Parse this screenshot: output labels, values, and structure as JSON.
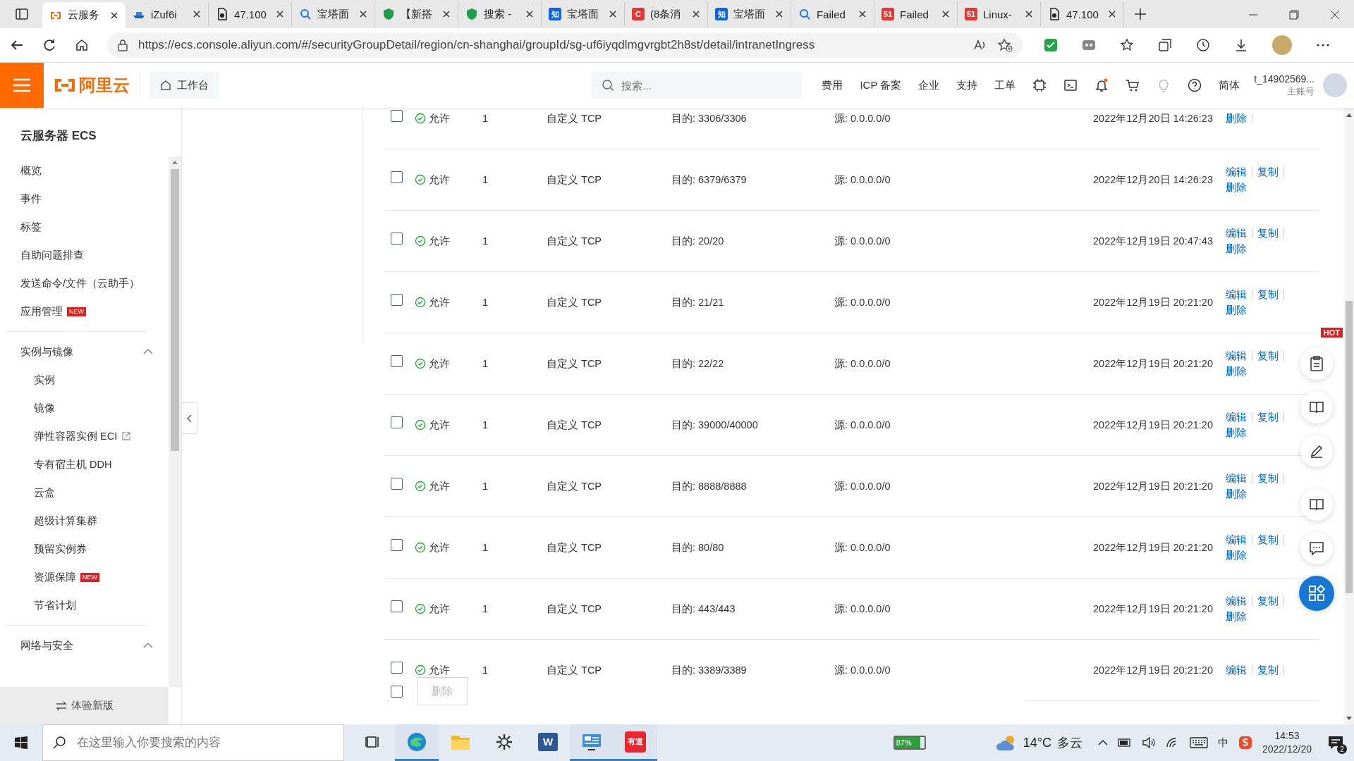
{
  "browser": {
    "tabs": [
      {
        "label": "云服务",
        "kind": "aliyun",
        "selected": true
      },
      {
        "label": "iZuf6i",
        "kind": "ship",
        "selected": false
      },
      {
        "label": "47.100",
        "kind": "doc",
        "selected": false
      },
      {
        "label": "宝塔面",
        "kind": "search",
        "selected": false
      },
      {
        "label": "【新搭",
        "kind": "shield",
        "selected": false
      },
      {
        "label": "搜索 -",
        "kind": "shield",
        "selected": false
      },
      {
        "label": "宝塔面",
        "kind": "badge",
        "icon_text": "知",
        "selected": false
      },
      {
        "label": "(8条消",
        "kind": "red",
        "icon_text": "C",
        "selected": false
      },
      {
        "label": "宝塔面",
        "kind": "badge",
        "icon_text": "知",
        "selected": false
      },
      {
        "label": "Failed",
        "kind": "search",
        "selected": false
      },
      {
        "label": "Failed",
        "kind": "red",
        "icon_text": "51",
        "selected": false
      },
      {
        "label": "Linux-",
        "kind": "red",
        "icon_text": "51",
        "selected": false
      },
      {
        "label": "47.100",
        "kind": "doc",
        "selected": false
      }
    ],
    "url": "https://ecs.console.aliyun.com/#/securityGroupDetail/region/cn-shanghai/groupId/sg-uf6iyqdlmgvrgbt2h8st/detail/intranetIngress"
  },
  "header": {
    "logo": "阿里云",
    "workbench": "工作台",
    "search_placeholder": "搜索...",
    "nav": [
      "费用",
      "ICP 备案",
      "企业",
      "支持",
      "工单"
    ],
    "language": "简体",
    "account": "t_14902569...",
    "account_role": "主账号"
  },
  "sidebar": {
    "title": "云服务器 ECS",
    "items": [
      {
        "label": "概览"
      },
      {
        "label": "事件"
      },
      {
        "label": "标签"
      },
      {
        "label": "自助问题排查"
      },
      {
        "label": "发送命令/文件（云助手）"
      },
      {
        "label": "应用管理",
        "badge": "NEW"
      }
    ],
    "groups": [
      {
        "label": "实例与镜像",
        "expanded": true,
        "children": [
          {
            "label": "实例"
          },
          {
            "label": "镜像"
          },
          {
            "label": "弹性容器实例 ECI",
            "external": true
          },
          {
            "label": "专有宿主机 DDH"
          },
          {
            "label": "云盒"
          },
          {
            "label": "超级计算集群"
          },
          {
            "label": "预留实例券"
          },
          {
            "label": "资源保障",
            "badge": "NEW"
          },
          {
            "label": "节省计划"
          }
        ]
      },
      {
        "label": "网络与安全",
        "expanded": true
      }
    ],
    "footer": "体验新版"
  },
  "rules": [
    {
      "checked": false,
      "policy": "允许",
      "priority": "1",
      "protocol": "自定义 TCP",
      "port": "目的: 3306/3306",
      "source": "源: 0.0.0.0/0",
      "time": "2022年12月20日 14:26:23",
      "actions": [
        "删除"
      ]
    },
    {
      "checked": false,
      "policy": "允许",
      "priority": "1",
      "protocol": "自定义 TCP",
      "port": "目的: 6379/6379",
      "source": "源: 0.0.0.0/0",
      "time": "2022年12月20日 14:26:23",
      "actions": [
        "编辑",
        "复制",
        "删除"
      ]
    },
    {
      "checked": false,
      "policy": "允许",
      "priority": "1",
      "protocol": "自定义 TCP",
      "port": "目的: 20/20",
      "source": "源: 0.0.0.0/0",
      "time": "2022年12月19日 20:47:43",
      "actions": [
        "编辑",
        "复制",
        "删除"
      ]
    },
    {
      "checked": false,
      "policy": "允许",
      "priority": "1",
      "protocol": "自定义 TCP",
      "port": "目的: 21/21",
      "source": "源: 0.0.0.0/0",
      "time": "2022年12月19日 20:21:20",
      "actions": [
        "编辑",
        "复制",
        "删除"
      ]
    },
    {
      "checked": false,
      "policy": "允许",
      "priority": "1",
      "protocol": "自定义 TCP",
      "port": "目的: 22/22",
      "source": "源: 0.0.0.0/0",
      "time": "2022年12月19日 20:21:20",
      "actions": [
        "编辑",
        "复制",
        "删除"
      ]
    },
    {
      "checked": false,
      "policy": "允许",
      "priority": "1",
      "protocol": "自定义 TCP",
      "port": "目的: 39000/40000",
      "source": "源: 0.0.0.0/0",
      "time": "2022年12月19日 20:21:20",
      "actions": [
        "编辑",
        "复制",
        "删除"
      ]
    },
    {
      "checked": false,
      "policy": "允许",
      "priority": "1",
      "protocol": "自定义 TCP",
      "port": "目的: 8888/8888",
      "source": "源: 0.0.0.0/0",
      "time": "2022年12月19日 20:21:20",
      "actions": [
        "编辑",
        "复制",
        "删除"
      ]
    },
    {
      "checked": false,
      "policy": "允许",
      "priority": "1",
      "protocol": "自定义 TCP",
      "port": "目的: 80/80",
      "source": "源: 0.0.0.0/0",
      "time": "2022年12月19日 20:21:20",
      "actions": [
        "编辑",
        "复制",
        "删除"
      ]
    },
    {
      "checked": false,
      "policy": "允许",
      "priority": "1",
      "protocol": "自定义 TCP",
      "port": "目的: 443/443",
      "source": "源: 0.0.0.0/0",
      "time": "2022年12月19日 20:21:20",
      "actions": [
        "编辑",
        "复制",
        "删除"
      ]
    },
    {
      "checked": false,
      "policy": "允许",
      "priority": "1",
      "protocol": "自定义 TCP",
      "port": "目的: 3389/3389",
      "source": "源: 0.0.0.0/0",
      "time": "2022年12月19日 20:21:20",
      "actions": [
        "编辑",
        "复制"
      ]
    }
  ],
  "bulk": {
    "checked": false,
    "delete_label": "删除",
    "disabled": true
  },
  "floating": {
    "badge": "HOT"
  },
  "taskbar": {
    "search_placeholder": "在这里输入你要搜索的内容",
    "apps": [
      {
        "kind": "taskview",
        "active": false
      },
      {
        "kind": "edge",
        "active": true
      },
      {
        "kind": "folder",
        "active": false
      },
      {
        "kind": "gear",
        "active": false
      },
      {
        "kind": "word",
        "active": false,
        "text": "W"
      },
      {
        "kind": "monitor",
        "active": true
      },
      {
        "kind": "youdao",
        "active": true,
        "text": "有道"
      }
    ],
    "battery": "87%",
    "temperature": "14°C",
    "weather": "多云",
    "ime": "中",
    "time": "14:53",
    "date": "2022/12/20",
    "notifications": "2"
  }
}
